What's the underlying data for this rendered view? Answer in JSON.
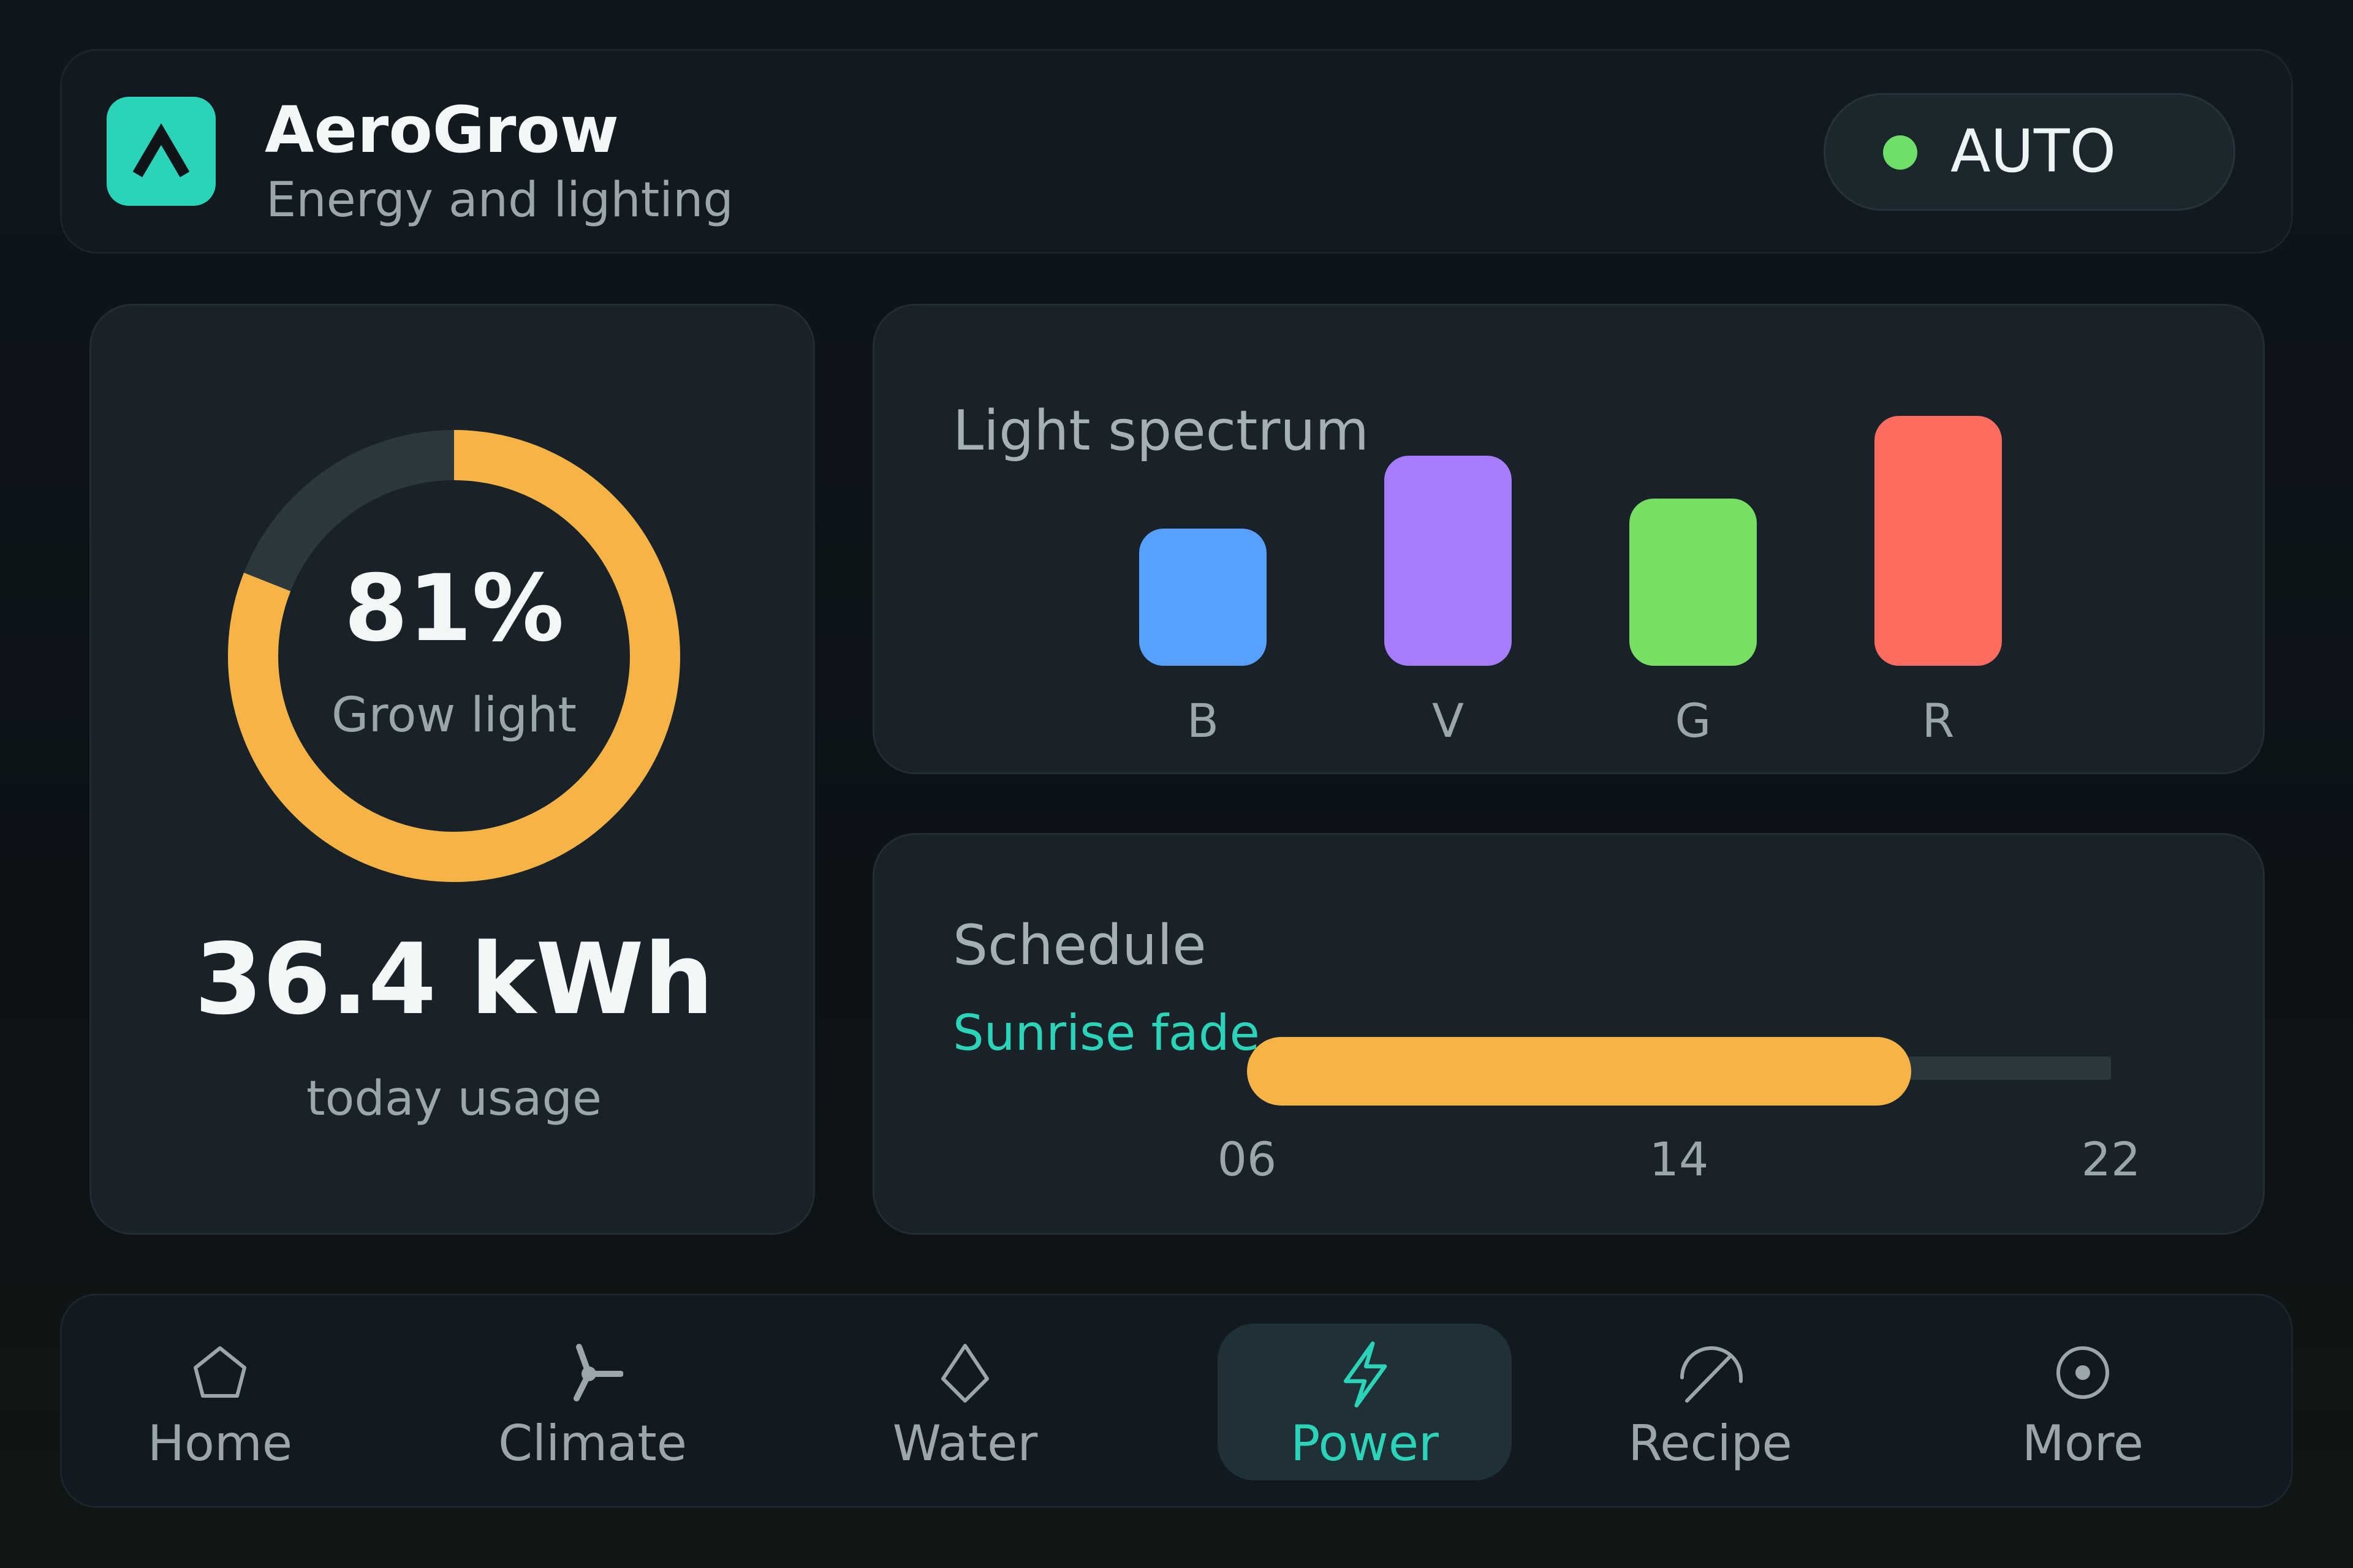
{
  "app": {
    "name": "AeroGrow",
    "subtitle": "Energy and lighting",
    "mode": {
      "label": "AUTO",
      "status_color": "#6ee06a"
    },
    "accent_color": "#2bd4b8"
  },
  "energy": {
    "grow_light_percent": 81,
    "grow_light_value": "81%",
    "grow_light_label": "Grow light",
    "usage_value": "36.4 kWh",
    "usage_label": "today usage",
    "ring_color": "#f5b445",
    "ring_track_color": "#2d383e"
  },
  "spectrum": {
    "title": "Light spectrum",
    "chart_data": {
      "type": "bar",
      "categories": [
        "B",
        "V",
        "G",
        "R"
      ],
      "values": [
        0.55,
        0.84,
        0.67,
        1.0
      ],
      "colors": [
        "#58a0ff",
        "#a57dfd",
        "#77e063",
        "#fd6c5e"
      ]
    }
  },
  "schedule": {
    "title": "Schedule",
    "program": "Sunrise fade",
    "ticks": [
      "06",
      "14",
      "22"
    ],
    "range_hours": [
      6,
      22
    ],
    "active_hours": [
      6,
      18.3
    ],
    "fill_color": "#f5b445"
  },
  "nav": {
    "items": [
      {
        "label": "Home",
        "icon": "home-icon",
        "active": false
      },
      {
        "label": "Climate",
        "icon": "fan-icon",
        "active": false
      },
      {
        "label": "Water",
        "icon": "droplet-icon",
        "active": false
      },
      {
        "label": "Power",
        "icon": "lightning-icon",
        "active": true
      },
      {
        "label": "Recipe",
        "icon": "gauge-icon",
        "active": false
      },
      {
        "label": "More",
        "icon": "more-circle-icon",
        "active": false
      }
    ]
  }
}
